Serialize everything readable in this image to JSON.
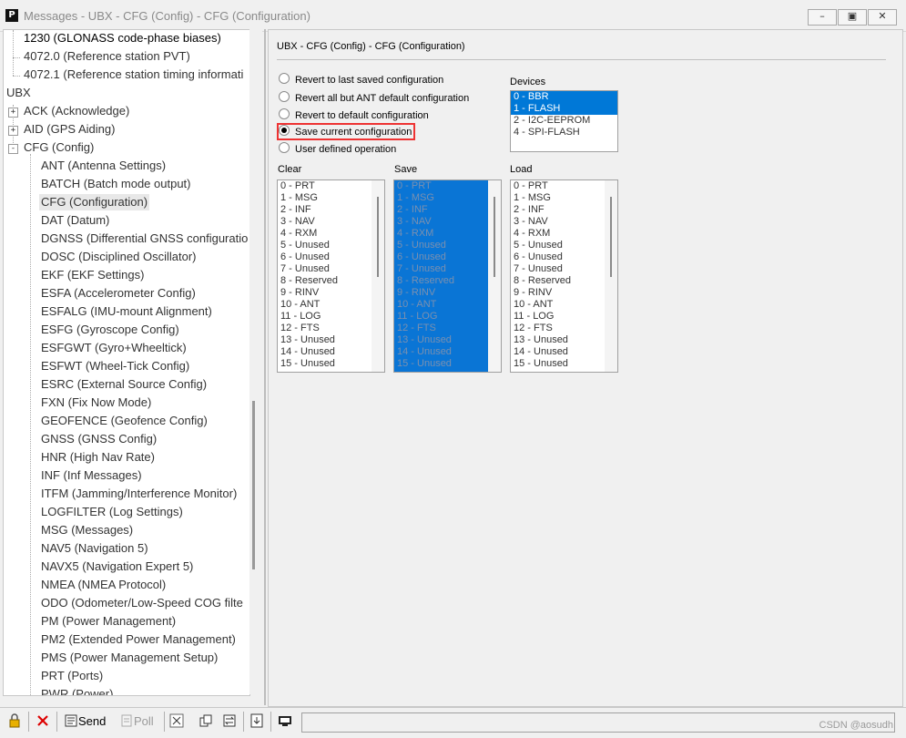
{
  "window": {
    "title": "Messages - UBX - CFG (Config) - CFG (Configuration)",
    "app_icon_glyph": "P",
    "controls": [
      "minimize-icon",
      "maximize-icon",
      "close-icon"
    ]
  },
  "tree": {
    "items": [
      {
        "label": "1230 (GLONASS code-phase biases)"
      },
      {
        "label": "4072.0 (Reference station PVT)"
      },
      {
        "label": "4072.1 (Reference station timing informati"
      },
      {
        "label": "UBX"
      },
      {
        "label": "ACK (Acknowledge)",
        "expander": "+"
      },
      {
        "label": "AID (GPS Aiding)",
        "expander": "+"
      },
      {
        "label": "CFG (Config)",
        "expander": "-"
      },
      {
        "label": "ANT (Antenna Settings)"
      },
      {
        "label": "BATCH (Batch mode output)"
      },
      {
        "label": "CFG (Configuration)"
      },
      {
        "label": "DAT (Datum)"
      },
      {
        "label": "DGNSS (Differential GNSS configuratio"
      },
      {
        "label": "DOSC (Disciplined Oscillator)"
      },
      {
        "label": "EKF (EKF Settings)"
      },
      {
        "label": "ESFA (Accelerometer Config)"
      },
      {
        "label": "ESFALG (IMU-mount Alignment)"
      },
      {
        "label": "ESFG (Gyroscope Config)"
      },
      {
        "label": "ESFGWT (Gyro+Wheeltick)"
      },
      {
        "label": "ESFWT (Wheel-Tick Config)"
      },
      {
        "label": "ESRC (External Source Config)"
      },
      {
        "label": "FXN (Fix Now Mode)"
      },
      {
        "label": "GEOFENCE (Geofence Config)"
      },
      {
        "label": "GNSS (GNSS Config)"
      },
      {
        "label": "HNR (High Nav Rate)"
      },
      {
        "label": "INF (Inf Messages)"
      },
      {
        "label": "ITFM (Jamming/Interference Monitor)"
      },
      {
        "label": "LOGFILTER (Log Settings)"
      },
      {
        "label": "MSG (Messages)"
      },
      {
        "label": "NAV5 (Navigation 5)"
      },
      {
        "label": "NAVX5 (Navigation Expert 5)"
      },
      {
        "label": "NMEA (NMEA Protocol)"
      },
      {
        "label": "ODO (Odometer/Low-Speed COG filte"
      },
      {
        "label": "PM (Power Management)"
      },
      {
        "label": "PM2 (Extended Power Management)"
      },
      {
        "label": "PMS (Power Management Setup)"
      },
      {
        "label": "PRT (Ports)"
      },
      {
        "label": "PWR (Power)"
      }
    ]
  },
  "panel": {
    "title": "UBX - CFG (Config) - CFG (Configuration)",
    "options": [
      {
        "label": "Revert to last saved configuration",
        "checked": false
      },
      {
        "label": "Revert all but ANT default configuration",
        "checked": false
      },
      {
        "label": "Revert to default configuration",
        "checked": false
      },
      {
        "label": "Save current configuration",
        "checked": true
      },
      {
        "label": "User defined operation",
        "checked": false
      }
    ],
    "devices_label": "Devices",
    "devices": [
      {
        "label": "0 - BBR",
        "selected": true
      },
      {
        "label": "1 - FLASH",
        "selected": true
      },
      {
        "label": "2 - I2C-EEPROM",
        "selected": false
      },
      {
        "label": "4 - SPI-FLASH",
        "selected": false
      }
    ],
    "clear_label": "Clear",
    "save_label": "Save",
    "load_label": "Load",
    "sections": [
      "0 - PRT",
      "1 - MSG",
      "2 - INF",
      "3 - NAV",
      "4 - RXM",
      "5 - Unused",
      "6 - Unused",
      "7 - Unused",
      "8 - Reserved",
      "9 - RINV",
      "10 - ANT",
      "11 - LOG",
      "12 - FTS",
      "13 - Unused",
      "14 - Unused",
      "15 - Unused"
    ]
  },
  "toolbar": {
    "send_label": "Send",
    "poll_label": "Poll"
  },
  "watermark": "CSDN @aosudh",
  "colors": {
    "selection": "#0078d7",
    "highlight_box": "#e33333"
  }
}
